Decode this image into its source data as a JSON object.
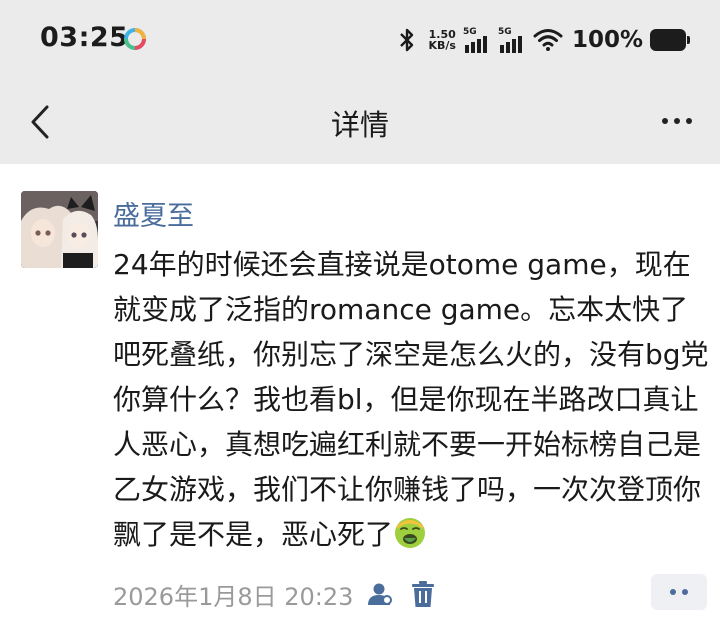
{
  "status_bar": {
    "time": "03:25",
    "net_speed_value": "1.50",
    "net_speed_unit": "KB/s",
    "signal_1_label": "5G",
    "signal_2_label": "5G",
    "battery_percent": "100%",
    "icons": [
      "app-notification-icon",
      "bluetooth-icon",
      "signal-icon",
      "wifi-icon",
      "battery-icon"
    ]
  },
  "header": {
    "title": "详情",
    "back_icon": "chevron-left-icon",
    "more_icon": "more-icon"
  },
  "comment": {
    "username": "盛夏至",
    "username_color": "#4a6d9c",
    "text": "24年的时候还会直接说是otome game，现在就变成了泛指的romance game。忘本太快了吧死叠纸，你别忘了深空是怎么火的，没有bg党你算什么？我也看bl，但是你现在半路改口真让人恶心，真想吃遍红利就不要一开始标榜自己是乙女游戏，我们不让你赚钱了吗，一次次登顶你飘了是不是，恶心死了",
    "emoji": "nauseated-face-emoji",
    "timestamp": "2026年1月8日 20:23",
    "action_icons": [
      "user-icon",
      "trash-icon",
      "more-icon"
    ]
  }
}
